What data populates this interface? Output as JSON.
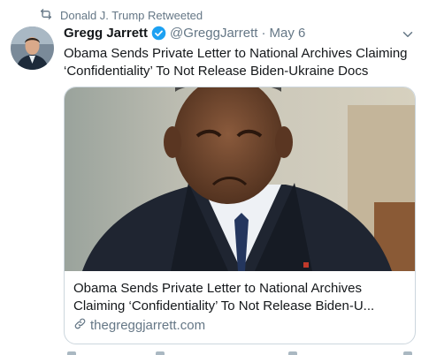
{
  "retweet": {
    "label": "Donald J. Trump Retweeted"
  },
  "tweet": {
    "author_name": "Gregg Jarrett",
    "handle": "@GreggJarrett",
    "separator": "·",
    "date": "May 6",
    "text": "Obama Sends Private Letter to National Archives Claiming ‘Confidentiality’ To Not Release Biden-Ukraine Docs"
  },
  "card": {
    "title": "Obama Sends Private Letter to National Archives Claiming ‘Confidentiality’ To Not Release Biden-U...",
    "domain": "thegreggjarrett.com"
  },
  "colors": {
    "verified_blue": "#1da1f2",
    "secondary_text": "#657786",
    "border": "#ccd6dd"
  },
  "icons": [
    "retweet-icon",
    "verified-badge-icon",
    "chevron-down-icon",
    "link-icon"
  ]
}
